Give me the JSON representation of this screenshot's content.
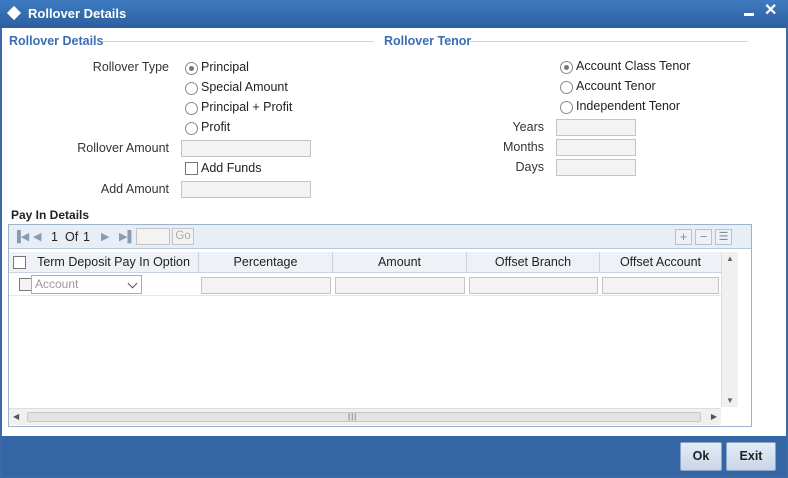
{
  "window": {
    "title": "Rollover Details"
  },
  "rollover_details": {
    "section_title": "Rollover Details",
    "rollover_type_label": "Rollover Type",
    "options": [
      "Principal",
      "Special Amount",
      "Principal + Profit",
      "Profit"
    ],
    "selected": "Principal",
    "rollover_amount_label": "Rollover Amount",
    "rollover_amount": "",
    "add_funds_label": "Add Funds",
    "add_funds_checked": false,
    "add_amount_label": "Add Amount",
    "add_amount": ""
  },
  "rollover_tenor": {
    "section_title": "Rollover Tenor",
    "options": [
      "Account Class Tenor",
      "Account Tenor",
      "Independent Tenor"
    ],
    "selected": "Account Class Tenor",
    "years_label": "Years",
    "months_label": "Months",
    "days_label": "Days",
    "years": "",
    "months": "",
    "days": ""
  },
  "pay_in": {
    "section_title": "Pay In Details",
    "pagination": {
      "current": "1",
      "of_label": "Of",
      "total": "1",
      "go_label": "Go"
    },
    "columns": [
      "Term Deposit Pay In Option",
      "Percentage",
      "Amount",
      "Offset Branch",
      "Offset Account"
    ],
    "rows": [
      {
        "option": "Account",
        "percentage": "",
        "amount": "",
        "offset_branch": "",
        "offset_account": ""
      }
    ]
  },
  "footer": {
    "ok_label": "Ok",
    "exit_label": "Exit"
  },
  "colors": {
    "title_bar": "#2c5f9e",
    "section_title": "#3a6db2",
    "footer": "#3465a4"
  }
}
